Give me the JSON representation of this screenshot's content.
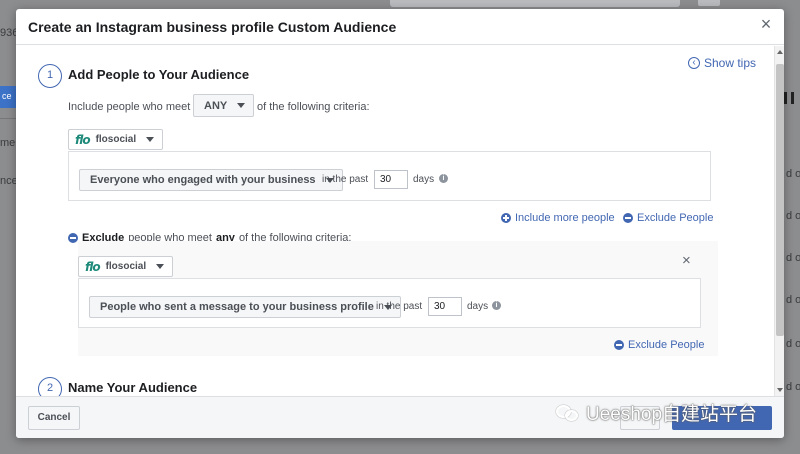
{
  "background": {
    "left_fragments": [
      "936",
      "ce",
      "me",
      "nce"
    ],
    "right_fragments": [
      "d on",
      "d on",
      "d on",
      "d on",
      "d on",
      "d on",
      "d on",
      "d on"
    ]
  },
  "modal": {
    "title": "Create an Instagram business profile Custom Audience",
    "show_tips": "Show tips",
    "step1": {
      "number": "1",
      "title": "Add People to Your Audience",
      "include_prefix": "Include people who meet",
      "match_value": "ANY",
      "include_suffix": "of the following criteria:",
      "source_label": "flosocial",
      "rule_label": "Everyone who engaged with your business",
      "in_the_past": "in the past",
      "days_value": "30",
      "days": "days",
      "include_more": "Include more people",
      "exclude_people": "Exclude People"
    },
    "exclude": {
      "word": "Exclude",
      "middle": "people who meet",
      "any": "any",
      "suffix": "of the following criteria:",
      "source_label": "flosocial",
      "rule_label": "People who sent a message to your business profile",
      "in_the_past": "in the past",
      "days_value": "30",
      "days": "days",
      "exclude_people": "Exclude People"
    },
    "step2": {
      "number": "2",
      "title": "Name Your Audience"
    },
    "footer": {
      "cancel": "Cancel"
    }
  },
  "watermark": "Ueeshop自建站平台",
  "logo_text": "flo",
  "colors": {
    "accent": "#4267b2",
    "brand_logo": "#1d8a7a"
  }
}
